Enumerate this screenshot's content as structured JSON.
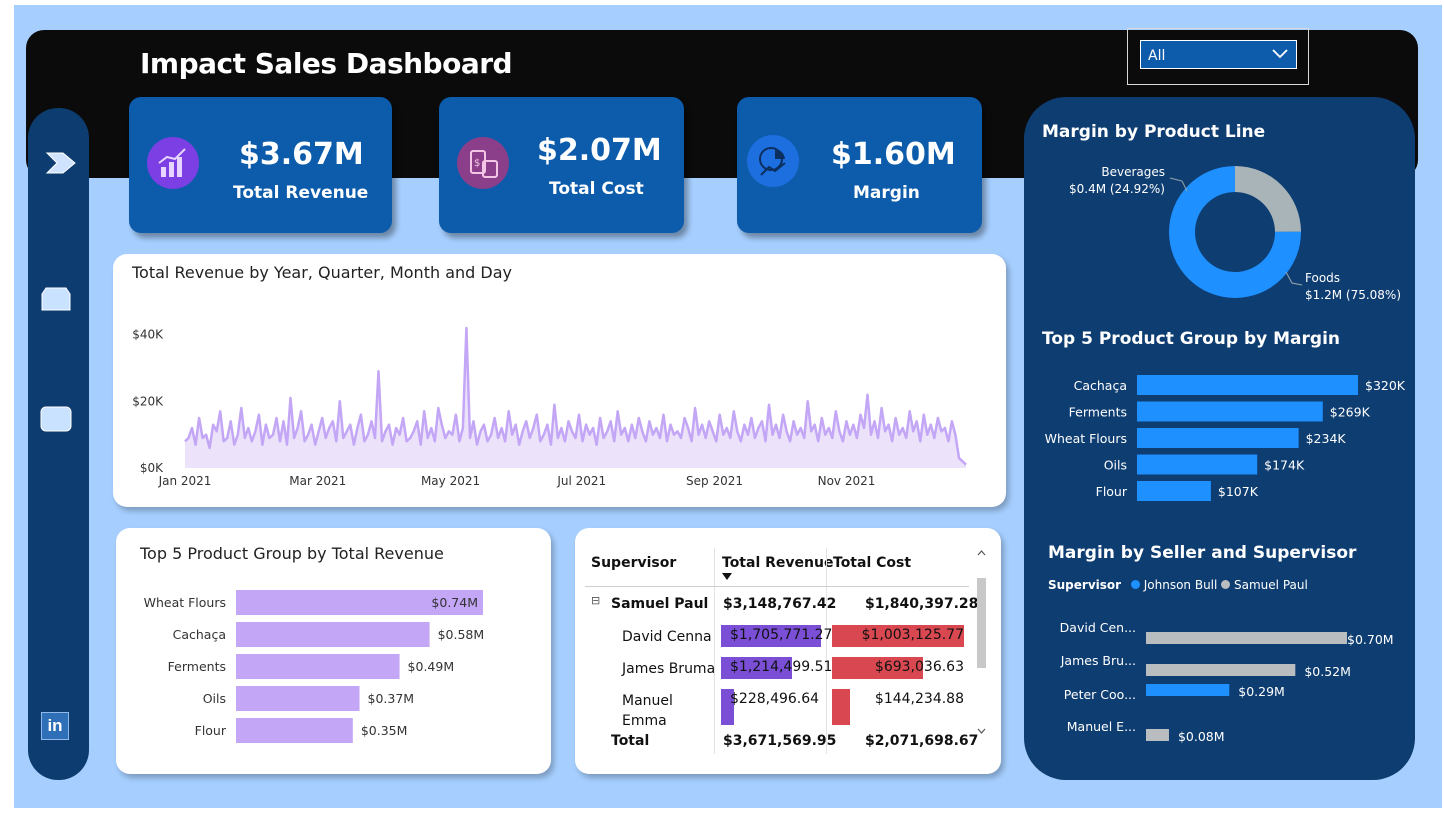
{
  "header": {
    "title": "Impact Sales Dashboard"
  },
  "slicer": {
    "value": "All"
  },
  "kpis": [
    {
      "value": "$3.67M",
      "label": "Total Revenue",
      "icon": "revenue-chart-icon",
      "color": "#7b3fe4"
    },
    {
      "value": "$2.07M",
      "label": "Total Cost",
      "icon": "cost-calculator-icon",
      "color": "#8b3f8a"
    },
    {
      "value": "$1.60M",
      "label": "Margin",
      "icon": "margin-pie-icon",
      "color": "#1d6fe0"
    }
  ],
  "nav": {
    "icons": [
      "chevron-right-icon",
      "panel-icon",
      "card-icon",
      "linkedin-icon"
    ],
    "linkedin_label": "in"
  },
  "revenue_line": {
    "title": "Total Revenue by Year, Quarter, Month and Day",
    "y_ticks": [
      "$0K",
      "$20K",
      "$40K"
    ],
    "x_ticks": [
      "Jan 2021",
      "Mar 2021",
      "May 2021",
      "Jul 2021",
      "Sep 2021",
      "Nov 2021"
    ]
  },
  "top5_revenue": {
    "title": "Top 5 Product Group by Total Revenue",
    "color": "#c3a6f5",
    "items": [
      {
        "label": "Wheat Flours",
        "value": 0.74,
        "text": "$0.74M"
      },
      {
        "label": "Cachaça",
        "value": 0.58,
        "text": "$0.58M"
      },
      {
        "label": "Ferments",
        "value": 0.49,
        "text": "$0.49M"
      },
      {
        "label": "Oils",
        "value": 0.37,
        "text": "$0.37M"
      },
      {
        "label": "Flour",
        "value": 0.35,
        "text": "$0.35M"
      }
    ]
  },
  "table": {
    "headers": [
      "Supervisor",
      "Total Revenue",
      "Total Cost"
    ],
    "group": {
      "name": "Samuel Paul",
      "revenue": "$3,148,767.42",
      "cost": "$1,840,397.28",
      "expand_symbol": "⊟"
    },
    "rows": [
      {
        "name": "David Cenna",
        "revenue": "$1,705,771.27",
        "cost": "$1,003,125.77",
        "rev_frac": 1.0,
        "cost_frac": 1.0
      },
      {
        "name": "James Bruma",
        "revenue": "$1,214,499.51",
        "cost": "$693,036.63",
        "rev_frac": 0.71,
        "cost_frac": 0.69
      },
      {
        "name": "Manuel\nEmma",
        "revenue": "$228,496.64",
        "cost": "$144,234.88",
        "rev_frac": 0.13,
        "cost_frac": 0.14
      }
    ],
    "total": {
      "label": "Total",
      "revenue": "$3,671,569.95",
      "cost": "$2,071,698.67"
    },
    "revenue_color": "#7a4fd6",
    "cost_color": "#d94850"
  },
  "margin_product_line": {
    "title": "Margin by Product Line",
    "slices": [
      {
        "name": "Foods",
        "value": 75.08,
        "label": "$1.2M (75.08%)",
        "color": "#1e90ff"
      },
      {
        "name": "Beverages",
        "value": 24.92,
        "label": "$0.4M (24.92%)",
        "color": "#a9b4b9"
      }
    ]
  },
  "top5_margin": {
    "title": "Top 5 Product Group by Margin",
    "color": "#1e90ff",
    "items": [
      {
        "label": "Cachaça",
        "value": 320,
        "text": "$320K"
      },
      {
        "label": "Ferments",
        "value": 269,
        "text": "$269K"
      },
      {
        "label": "Wheat Flours",
        "value": 234,
        "text": "$234K"
      },
      {
        "label": "Oils",
        "value": 174,
        "text": "$174K"
      },
      {
        "label": "Flour",
        "value": 107,
        "text": "$107K"
      }
    ]
  },
  "margin_seller": {
    "title": "Margin by Seller and Supervisor",
    "legend_title": "Supervisor",
    "legend": [
      {
        "name": "Johnson Bull",
        "color": "#1e90ff"
      },
      {
        "name": "Samuel Paul",
        "color": "#b9bdbf"
      }
    ],
    "items": [
      {
        "label": "David Cen...",
        "value": 0.7,
        "text": "$0.70M",
        "color": "#b9bdbf"
      },
      {
        "label": "James Bru...",
        "value": 0.52,
        "text": "$0.52M",
        "color": "#b9bdbf"
      },
      {
        "label": "Peter Coo...",
        "value": 0.29,
        "text": "$0.29M",
        "color": "#1e90ff"
      },
      {
        "label": "Manuel E...",
        "value": 0.08,
        "text": "$0.08M",
        "color": "#b9bdbf"
      }
    ]
  },
  "chart_data": [
    {
      "type": "area",
      "title": "Total Revenue by Year, Quarter, Month and Day",
      "x_range": [
        "2021-01-01",
        "2021-12-31"
      ],
      "ylim": [
        0,
        45000
      ],
      "y_ticks": [
        "$0K",
        "$20K",
        "$40K"
      ],
      "x_ticks": [
        "Jan 2021",
        "Mar 2021",
        "May 2021",
        "Jul 2021",
        "Sep 2021",
        "Nov 2021"
      ],
      "color": "#c3a6f5",
      "series": [
        {
          "values": [
            8000,
            9000,
            12000,
            7000,
            15000,
            9000,
            10000,
            6000,
            13000,
            11000,
            17000,
            8000,
            9000,
            14000,
            7000,
            10000,
            18000,
            9000,
            12000,
            8000,
            11000,
            16000,
            7000,
            13000,
            9000,
            10000,
            15000,
            8000,
            14000,
            7000,
            21000,
            9000,
            12000,
            17000,
            8000,
            10000,
            13000,
            7000,
            11000,
            15000,
            9000,
            12000,
            14000,
            8000,
            20000,
            9000,
            11000,
            13000,
            7000,
            12000,
            16000,
            8000,
            10000,
            14000,
            9000,
            29000,
            8000,
            11000,
            13000,
            7000,
            12000,
            10000,
            15000,
            8000,
            9000,
            11000,
            14000,
            7000,
            17000,
            9000,
            12000,
            8000,
            18000,
            13000,
            9000,
            11000,
            10000,
            16000,
            8000,
            12000,
            42000,
            9000,
            14000,
            7000,
            11000,
            13000,
            8000,
            10000,
            15000,
            9000,
            12000,
            8000,
            17000,
            10000,
            13000,
            7000,
            11000,
            14000,
            9000,
            12000,
            16000,
            8000,
            10000,
            13000,
            7000,
            19000,
            9000,
            12000,
            8000,
            14000,
            11000,
            9000,
            16000,
            8000,
            13000,
            10000,
            12000,
            7000,
            15000,
            9000,
            11000,
            14000,
            8000,
            17000,
            10000,
            12000,
            8000,
            13000,
            9000,
            15000,
            11000,
            8000,
            14000,
            10000,
            12000,
            9000,
            16000,
            8000,
            13000,
            10000,
            11000,
            9000,
            15000,
            12000,
            8000,
            18000,
            10000,
            13000,
            9000,
            14000,
            11000,
            8000,
            16000,
            10000,
            12000,
            9000,
            17000,
            11000,
            8000,
            13000,
            10000,
            15000,
            9000,
            12000,
            14000,
            8000,
            19000,
            10000,
            13000,
            9000,
            16000,
            11000,
            8000,
            14000,
            10000,
            12000,
            9000,
            20000,
            11000,
            13000,
            8000,
            15000,
            10000,
            12000,
            9000,
            17000,
            11000,
            8000,
            14000,
            10000,
            13000,
            9000,
            16000,
            12000,
            22000,
            10000,
            14000,
            9000,
            18000,
            11000,
            13000,
            8000,
            15000,
            10000,
            12000,
            9000,
            17000,
            11000,
            14000,
            8000,
            16000,
            10000,
            13000,
            9000,
            15000,
            11000,
            12000,
            8000,
            14000,
            10000,
            3000,
            2000,
            1000
          ]
        }
      ]
    },
    {
      "type": "bar",
      "title": "Top 5 Product Group by Total Revenue",
      "categories": [
        "Wheat Flours",
        "Cachaça",
        "Ferments",
        "Oils",
        "Flour"
      ],
      "values": [
        0.74,
        0.58,
        0.49,
        0.37,
        0.35
      ],
      "data_labels": [
        "$0.74M",
        "$0.58M",
        "$0.49M",
        "$0.37M",
        "$0.35M"
      ]
    },
    {
      "type": "pie",
      "title": "Margin by Product Line",
      "categories": [
        "Foods",
        "Beverages"
      ],
      "values": [
        75.08,
        24.92
      ],
      "data_labels": [
        "$1.2M (75.08%)",
        "$0.4M (24.92%)"
      ]
    },
    {
      "type": "bar",
      "title": "Top 5 Product Group by Margin",
      "categories": [
        "Cachaça",
        "Ferments",
        "Wheat Flours",
        "Oils",
        "Flour"
      ],
      "values": [
        320,
        269,
        234,
        174,
        107
      ],
      "data_labels": [
        "$320K",
        "$269K",
        "$234K",
        "$174K",
        "$107K"
      ]
    },
    {
      "type": "bar",
      "title": "Margin by Seller and Supervisor",
      "categories": [
        "David Cen...",
        "James Bru...",
        "Peter Coo...",
        "Manuel E..."
      ],
      "values": [
        0.7,
        0.52,
        0.29,
        0.08
      ],
      "data_labels": [
        "$0.70M",
        "$0.52M",
        "$0.29M",
        "$0.08M"
      ],
      "legend": [
        "Johnson Bull",
        "Samuel Paul"
      ]
    }
  ]
}
